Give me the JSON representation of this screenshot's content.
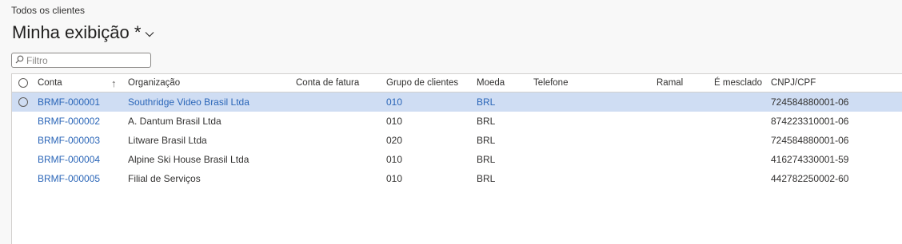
{
  "breadcrumb": "Todos os clientes",
  "view": {
    "title": "Minha exibição *"
  },
  "filter": {
    "placeholder": "Filtro",
    "value": ""
  },
  "grid": {
    "columns": {
      "conta": "Conta",
      "organizacao": "Organização",
      "conta_fatura": "Conta de fatura",
      "grupo": "Grupo de clientes",
      "moeda": "Moeda",
      "telefone": "Telefone",
      "ramal": "Ramal",
      "mesclado": "É mesclado",
      "cnpj": "CNPJ/CPF"
    },
    "sort": {
      "column": "Conta",
      "direction": "ascending"
    },
    "selected_row": 0,
    "rows": [
      {
        "conta": "BRMF-000001",
        "organizacao": "Southridge Video Brasil Ltda",
        "conta_fatura": "",
        "grupo": "010",
        "moeda": "BRL",
        "telefone": "",
        "ramal": "",
        "mesclado": "",
        "cnpj": "724584880001-06"
      },
      {
        "conta": "BRMF-000002",
        "organizacao": "A. Dantum Brasil Ltda",
        "conta_fatura": "",
        "grupo": "010",
        "moeda": "BRL",
        "telefone": "",
        "ramal": "",
        "mesclado": "",
        "cnpj": "874223310001-06"
      },
      {
        "conta": "BRMF-000003",
        "organizacao": "Litware Brasil Ltda",
        "conta_fatura": "",
        "grupo": "020",
        "moeda": "BRL",
        "telefone": "",
        "ramal": "",
        "mesclado": "",
        "cnpj": "724584880001-06"
      },
      {
        "conta": "BRMF-000004",
        "organizacao": "Alpine Ski House Brasil Ltda",
        "conta_fatura": "",
        "grupo": "010",
        "moeda": "BRL",
        "telefone": "",
        "ramal": "",
        "mesclado": "",
        "cnpj": "416274330001-59"
      },
      {
        "conta": "BRMF-000005",
        "organizacao": "Filial de Serviços",
        "conta_fatura": "",
        "grupo": "010",
        "moeda": "BRL",
        "telefone": "",
        "ramal": "",
        "mesclado": "",
        "cnpj": "442782250002-60"
      }
    ]
  },
  "colors": {
    "link": "#2b66b8",
    "selected_row": "#cfddf3",
    "header_border": "#d2d0ce"
  },
  "icons": {
    "chevron": "chevron-down-icon",
    "search": "search-icon",
    "sort": "sort-ascending-icon"
  }
}
